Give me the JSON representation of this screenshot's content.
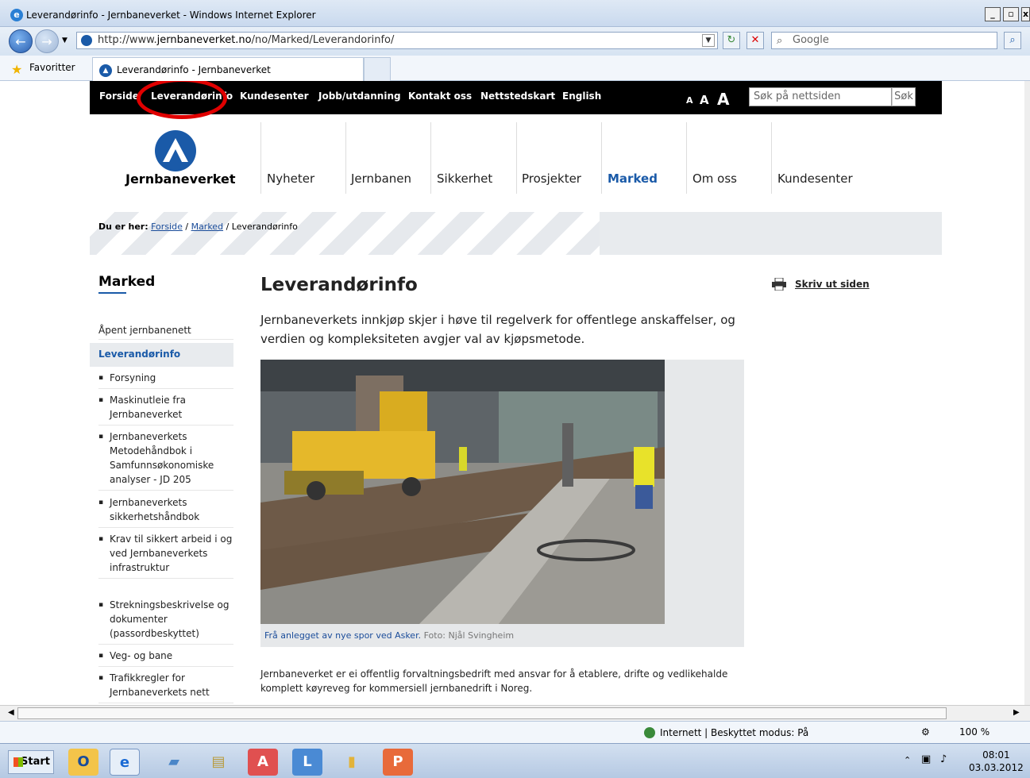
{
  "window": {
    "title": "Leverandørinfo - Jernbaneverket - Windows Internet Explorer",
    "min_btn": "_",
    "max_btn": "▫",
    "close_btn": "x"
  },
  "browser": {
    "address_prefix": "http://www.",
    "address_domain": "jernbaneverket.no",
    "address_path": "/no/Marked/Leverandorinfo/",
    "search_placeholder": "Google",
    "favorites_label": "Favoritter",
    "tab_title": "Leverandørinfo - Jernbaneverket"
  },
  "site": {
    "top_nav": [
      "Forside",
      "Leverandørinfo",
      "Kundesenter",
      "Jobb/utdanning",
      "Kontakt oss",
      "Nettstedskart",
      "English"
    ],
    "text_size": [
      "A",
      "A",
      "A"
    ],
    "search_placeholder": "Søk på nettsiden",
    "search_button": "Søk",
    "logo_text": "Jernbaneverket",
    "main_nav": [
      "Nyheter",
      "Jernbanen",
      "Sikkerhet",
      "Prosjekter",
      "Marked",
      "Om oss",
      "Kundesenter"
    ],
    "active_main_nav": "Marked"
  },
  "breadcrumb": {
    "prefix": "Du er her:",
    "items": [
      "Forside",
      "Marked"
    ],
    "current": "Leverandørinfo",
    "separator": "/"
  },
  "sidebar": {
    "title": "Marked",
    "items": [
      {
        "label": "Åpent jernbanenett"
      },
      {
        "label": "Leverandørinfo",
        "active": true
      }
    ],
    "subitems": [
      "Forsyning",
      "Maskinutleie fra Jernbaneverket",
      "Jernbaneverkets Metodehåndbok i Samfunnsøkonomiske analyser - JD 205",
      "Jernbaneverkets sikkerhetshåndbok",
      "Krav til sikkert arbeid i og ved Jernbaneverkets infrastruktur",
      "Strekningsbeskrivelse og dokumenter (passordbeskyttet)",
      "Veg- og bane",
      "Trafikkregler for Jernbaneverkets nett"
    ]
  },
  "main": {
    "title": "Leverandørinfo",
    "ingress": "Jernbaneverkets innkjøp skjer i høve til regelverk for offentlege anskaffelser, og verdien og kompleksiteten avgjer val av kjøpsmetode.",
    "print_label": "Skriv ut siden",
    "caption": "Frå anlegget av nye spor ved Asker.",
    "credit": "Foto: Njål Svingheim",
    "body": "Jernbaneverket er ei offentlig forvaltningsbedrift med ansvar for å etablere, drifte og vedlikehalde komplett køyreveg for kommersiell jernbanedrift i Noreg."
  },
  "status": {
    "zone": "Internett | Beskyttet modus: På",
    "zoom": "100 %"
  },
  "taskbar": {
    "start": "Start",
    "time": "08:01",
    "date": "03.03.2012"
  },
  "colors": {
    "accent": "#1a5aa8",
    "top_nav_bg": "#000000",
    "highlight_circle": "#e00000"
  }
}
